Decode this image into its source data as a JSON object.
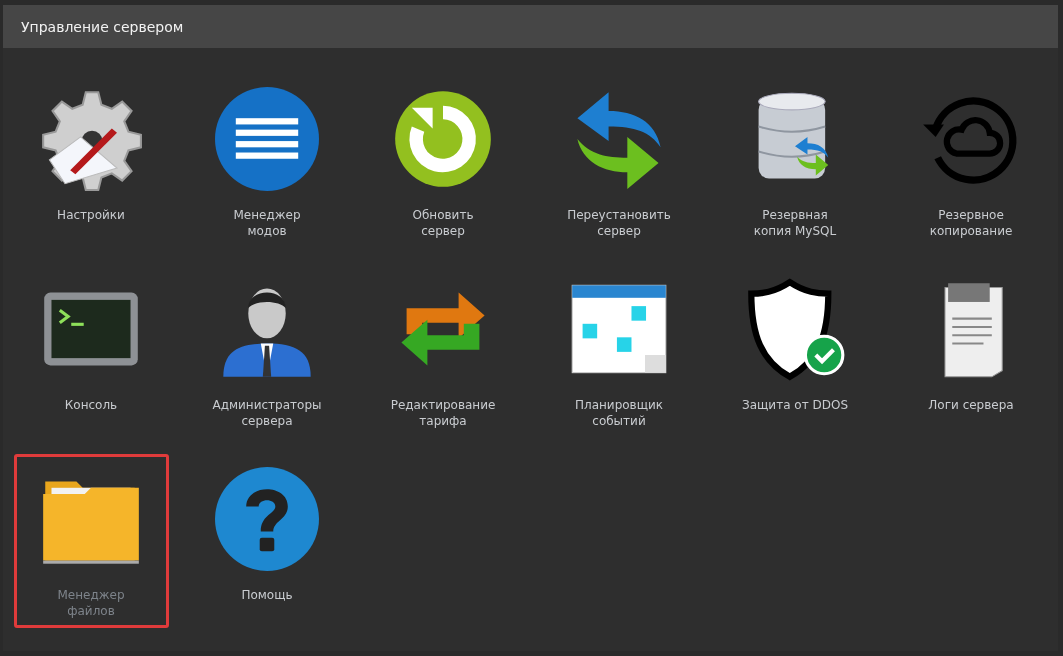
{
  "panel": {
    "title": "Управление сервером"
  },
  "items": [
    {
      "label": "Настройки",
      "selected": false
    },
    {
      "label": "Менеджер\nмодов",
      "selected": false
    },
    {
      "label": "Обновить\nсервер",
      "selected": false
    },
    {
      "label": "Переустановить\nсервер",
      "selected": false
    },
    {
      "label": "Резервная\nкопия MySQL",
      "selected": false
    },
    {
      "label": "Резервное\nкопирование",
      "selected": false
    },
    {
      "label": "Консоль",
      "selected": false
    },
    {
      "label": "Администраторы\nсервера",
      "selected": false
    },
    {
      "label": "Редактирование\nтарифа",
      "selected": false
    },
    {
      "label": "Планировщик\nсобытий",
      "selected": false
    },
    {
      "label": "Защита от DDOS",
      "selected": false
    },
    {
      "label": "Логи сервера",
      "selected": false
    },
    {
      "label": "Менеджер\nфайлов",
      "selected": true
    },
    {
      "label": "Помощь",
      "selected": false
    }
  ]
}
